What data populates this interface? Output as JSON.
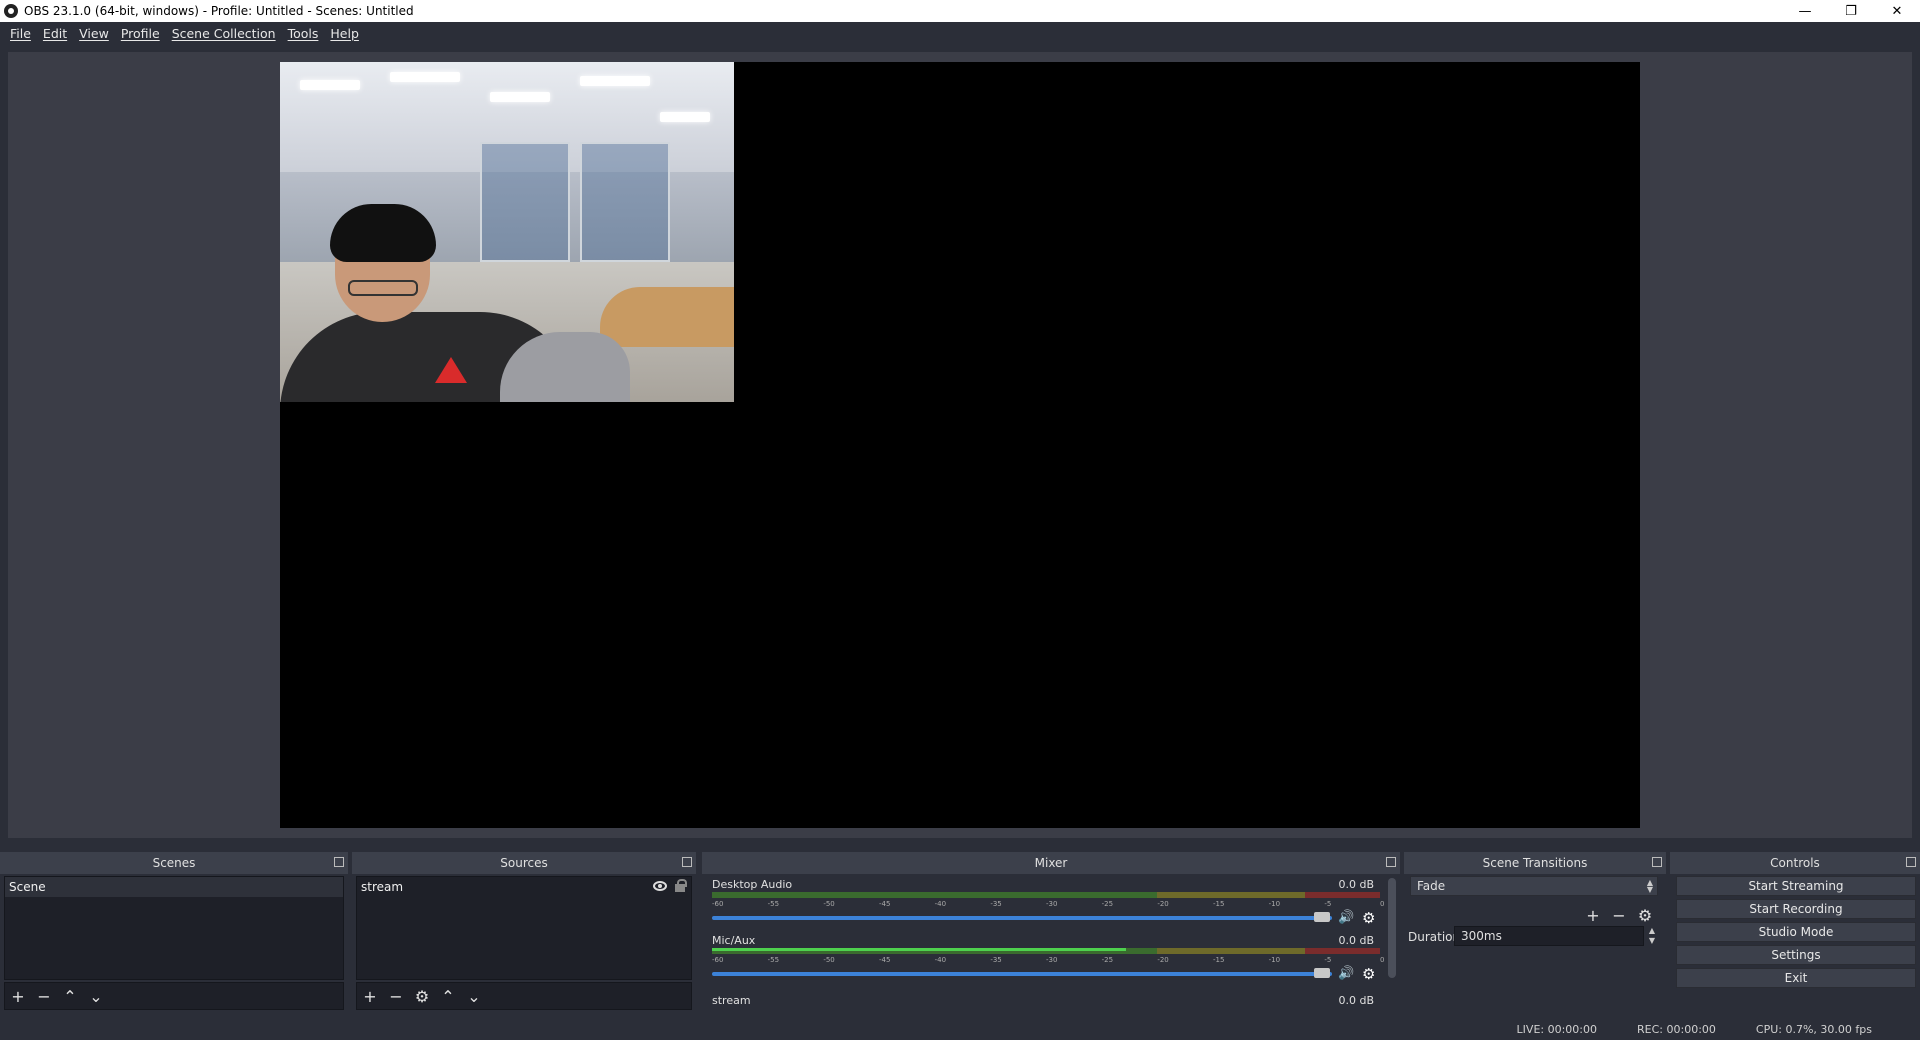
{
  "window": {
    "title": "OBS 23.1.0 (64-bit, windows) - Profile: Untitled - Scenes: Untitled",
    "minimize": "—",
    "maximize": "❐",
    "close": "✕"
  },
  "menu": [
    "File",
    "Edit",
    "View",
    "Profile",
    "Scene Collection",
    "Tools",
    "Help"
  ],
  "scenes": {
    "header": "Scenes",
    "items": [
      "Scene"
    ]
  },
  "sources": {
    "header": "Sources",
    "items": [
      "stream"
    ]
  },
  "mixer": {
    "header": "Mixer",
    "channels": [
      {
        "name": "Desktop Audio",
        "db": "0.0 dB",
        "volume": 1.0,
        "level": 0.0
      },
      {
        "name": "Mic/Aux",
        "db": "0.0 dB",
        "volume": 1.0,
        "level": 0.62
      }
    ],
    "third_channel": {
      "name": "stream",
      "db": "0.0 dB"
    },
    "ticks": [
      "-60",
      "-55",
      "-50",
      "-45",
      "-40",
      "-35",
      "-30",
      "-25",
      "-20",
      "-15",
      "-10",
      "-5",
      "0"
    ]
  },
  "transitions": {
    "header": "Scene Transitions",
    "selected": "Fade",
    "duration_label": "Duration",
    "duration_value": "300ms"
  },
  "controls": {
    "header": "Controls",
    "buttons": [
      "Start Streaming",
      "Start Recording",
      "Studio Mode",
      "Settings",
      "Exit"
    ]
  },
  "status": {
    "live": "LIVE: 00:00:00",
    "rec": "REC: 00:00:00",
    "cpu": "CPU: 0.7%, 30.00 fps"
  }
}
